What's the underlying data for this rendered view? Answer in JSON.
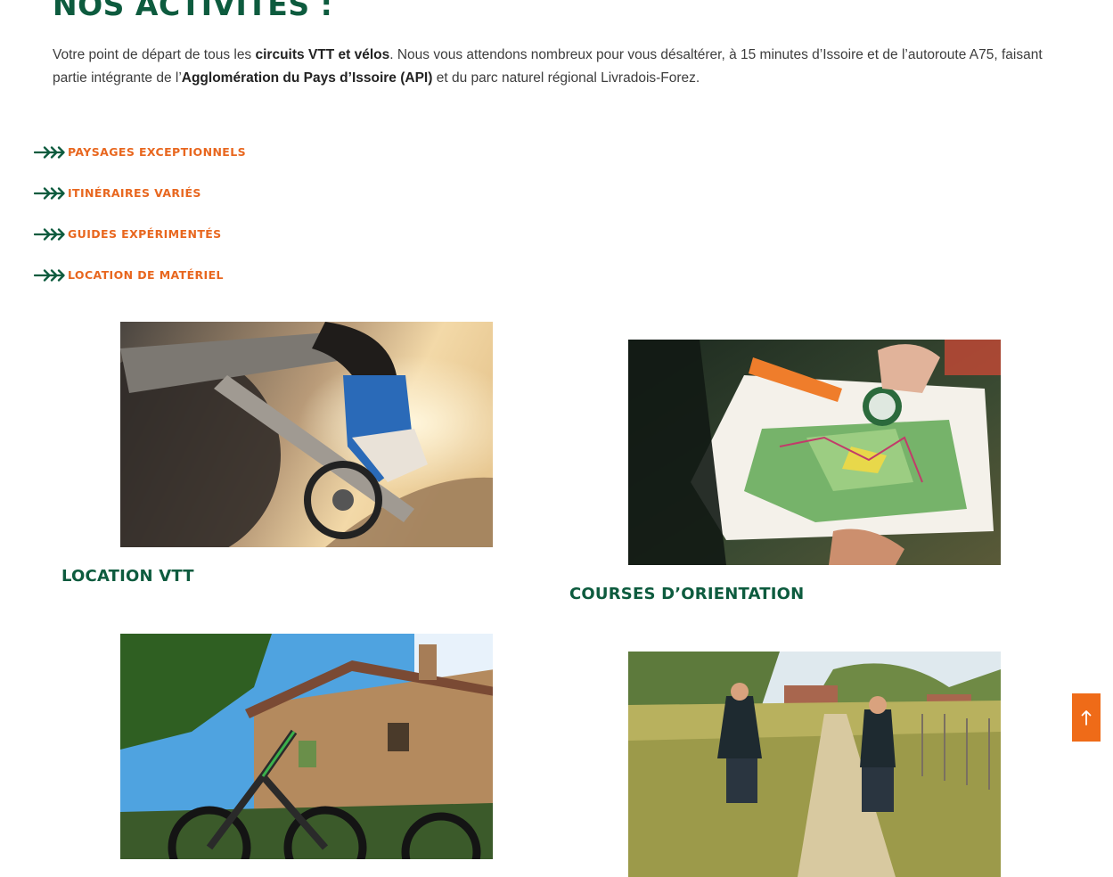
{
  "section": {
    "title": "NOS ACTIVITÉS :",
    "intro": {
      "p1": "Votre point de départ de tous les ",
      "b1": "circuits VTT et vélos",
      "p2": ". Nous vous attendons nombreux pour vous désaltérer, à 15 minutes d’Issoire et de l’autoroute A75, faisant partie intégrante de l’",
      "b2": "Agglomération du Pays d’Issoire (API)",
      "p3": " et du parc naturel régional Livradois-Forez."
    }
  },
  "features": [
    {
      "label": "PAYSAGES EXCEPTIONNELS",
      "icon": "triple-chevron-arrow-icon"
    },
    {
      "label": "ITINÉRAIRES VARIÉS",
      "icon": "triple-chevron-arrow-icon"
    },
    {
      "label": "GUIDES EXPÉRIMENTÉS",
      "icon": "triple-chevron-arrow-icon"
    },
    {
      "label": "LOCATION DE MATÉRIEL",
      "icon": "triple-chevron-arrow-icon"
    }
  ],
  "activities": [
    {
      "title": "LOCATION VTT",
      "image": "mountain-bike-pedal-photo"
    },
    {
      "title": "COURSES D’ORIENTATION",
      "image": "orienteering-map-compass-photo"
    },
    {
      "title": "",
      "image": "electric-bikes-stone-house-photo"
    },
    {
      "title": "",
      "image": "cyclists-countryside-path-photo"
    }
  ],
  "scroll_top": {
    "icon": "arrow-up-icon"
  },
  "colors": {
    "primary_green": "#0d5b3e",
    "accent_orange": "#e8671f",
    "button_orange": "#ef6b18",
    "text": "#3d3d3d"
  }
}
